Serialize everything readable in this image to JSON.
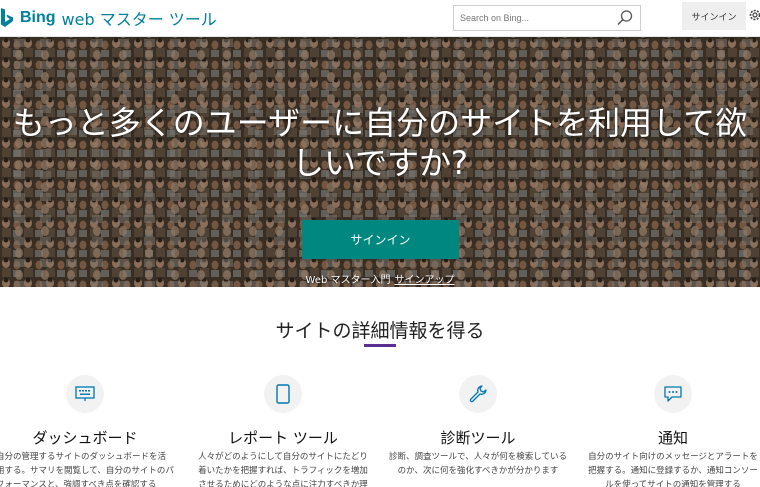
{
  "header": {
    "brand": "Bing",
    "product": "web マスター ツール",
    "search_placeholder": "Search on Bing...",
    "signin_label": "サインイン"
  },
  "hero": {
    "title": "もっと多くのユーザーに自分のサイトを利用して欲しいですか?",
    "button_label": "サインイン",
    "sub_text": "Web マスター入門",
    "sub_link": "サインアップ"
  },
  "section": {
    "title": "サイトの詳細情報を得る"
  },
  "features": [
    {
      "icon": "keyboard-icon",
      "title": "ダッシュボード",
      "desc": "自分の管理するサイトのダッシュボードを活用する。サマリを閲覧して、自分のサイトのパフォーマンスと、強調すべき点を確認する"
    },
    {
      "icon": "document-icon",
      "title": "レポート ツール",
      "desc": "人々がどのようにして自分のサイトにたどり着いたかを把握すれば、トラフィックを増加させるためにどのような点に注力すべきか理"
    },
    {
      "icon": "wrench-icon",
      "title": "診断ツール",
      "desc": "診断、調査ツールで、人々が何を検索しているのか、次に何を強化すべきかが分かります"
    },
    {
      "icon": "message-icon",
      "title": "通知",
      "desc": "自分のサイト向けのメッセージとアラートを把握する。通知に登録するか、通知コンソールを使ってサイトの通知を管理する"
    }
  ],
  "colors": {
    "brand": "#00809d",
    "accent": "#00877f",
    "underline": "#5c2d91"
  }
}
